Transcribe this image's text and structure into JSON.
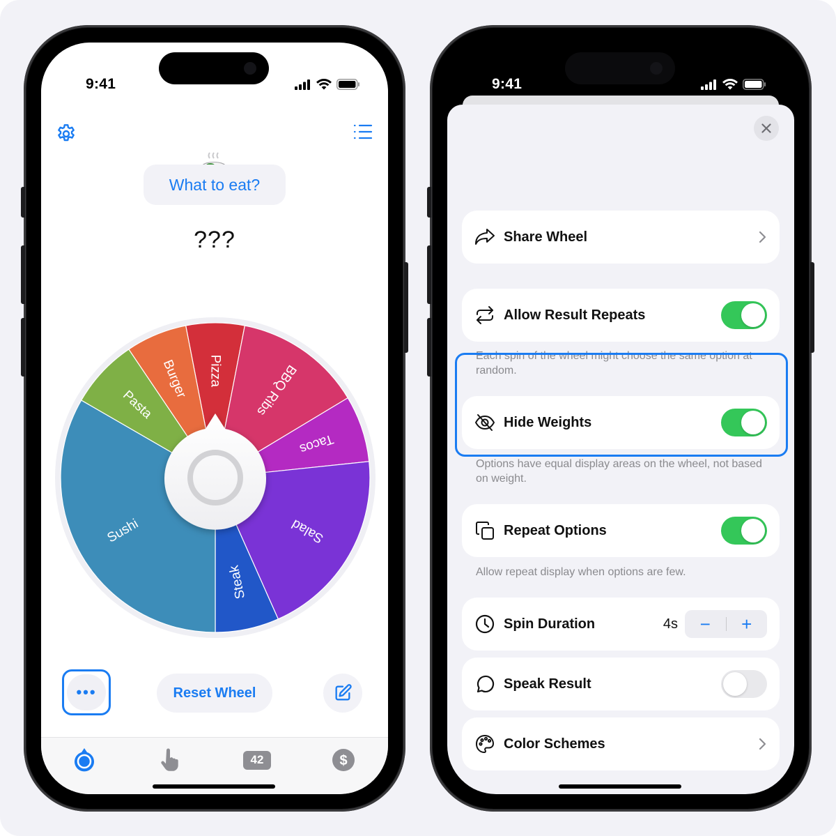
{
  "status_bar": {
    "time": "9:41"
  },
  "left_phone": {
    "header": {
      "settings_icon": "gear-icon",
      "list_icon": "list-bullet-icon",
      "emoji_icon": "steaming-bowl-icon",
      "title": "What to eat?"
    },
    "result": "???",
    "wheel": {
      "center_button_icon": "spin-ring-icon",
      "segments": [
        {
          "label": "Pizza",
          "color": "#d32f3a"
        },
        {
          "label": "BBQ Ribs",
          "color": "#d6366a"
        },
        {
          "label": "Tacos",
          "color": "#b42ac2"
        },
        {
          "label": "Salad",
          "color": "#7a33d6"
        },
        {
          "label": "Steak",
          "color": "#2157c8"
        },
        {
          "label": "Sushi",
          "color": "#3d8db9"
        },
        {
          "label": "Pasta",
          "color": "#7fb046"
        },
        {
          "label": "Burger",
          "color": "#e86c3e"
        }
      ]
    },
    "actions": {
      "more_label": "•••",
      "reset_label": "Reset Wheel",
      "edit_icon": "square-pencil-icon"
    },
    "tabbar": [
      {
        "name": "wheel",
        "icon": "wheel-icon",
        "active": true
      },
      {
        "name": "tap",
        "icon": "hand-point-icon",
        "active": false
      },
      {
        "name": "number",
        "label": "42",
        "active": false
      },
      {
        "name": "pro",
        "icon": "dollar-circle-icon",
        "active": false
      }
    ]
  },
  "right_phone": {
    "close_icon": "close-icon",
    "rows": {
      "share": {
        "label": "Share Wheel",
        "icon": "share-arrow-icon"
      },
      "allow_repeats": {
        "label": "Allow Result Repeats",
        "icon": "repeat-arrows-icon",
        "on": true,
        "footnote": "Each spin of the wheel might choose the same option at random."
      },
      "hide_weights": {
        "label": "Hide Weights",
        "icon": "eye-slash-icon",
        "on": true,
        "footnote": "Options have equal display areas on the wheel, not based on weight."
      },
      "repeat_options": {
        "label": "Repeat Options",
        "icon": "copy-squares-icon",
        "on": true,
        "footnote": "Allow repeat display when options are few."
      },
      "spin_duration": {
        "label": "Spin Duration",
        "icon": "clock-icon",
        "value": "4s",
        "minus": "−",
        "plus": "+"
      },
      "speak_result": {
        "label": "Speak Result",
        "icon": "speech-bubble-icon",
        "on": false
      },
      "color_schemes": {
        "label": "Color Schemes",
        "icon": "palette-icon"
      }
    }
  },
  "colors": {
    "accent": "#1a7cf2",
    "toggle_on": "#34c759",
    "page_bg": "#f2f2f7"
  }
}
